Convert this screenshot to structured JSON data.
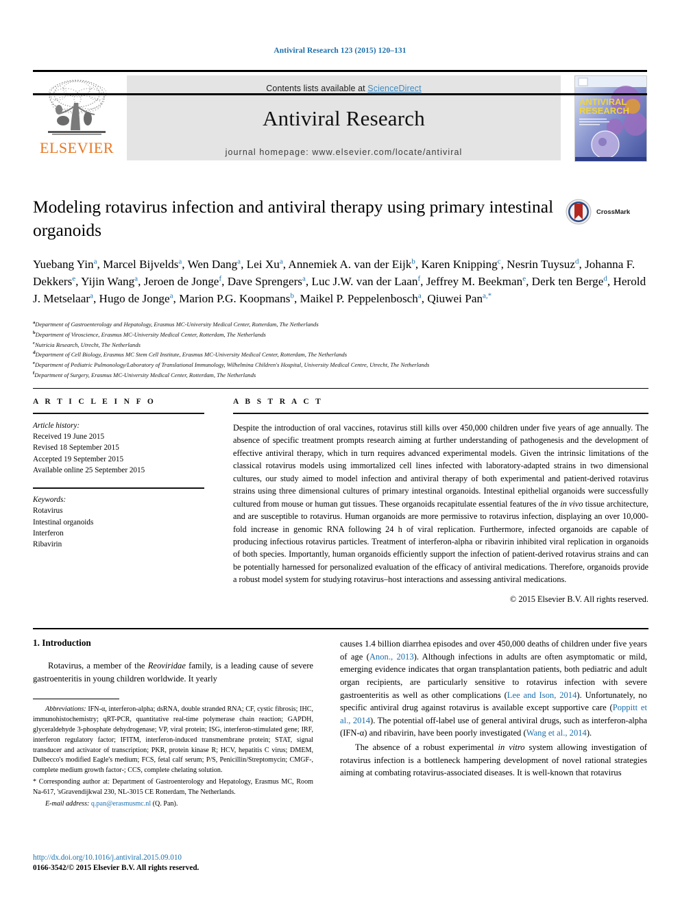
{
  "running_head": "Antiviral Research 123 (2015) 120–131",
  "masthead": {
    "contents_prefix": "Contents lists available at ",
    "science_direct": "ScienceDirect",
    "journal_name": "Antiviral Research",
    "homepage": "journal homepage: www.elsevier.com/locate/antiviral",
    "publisher_wordmark": "ELSEVIER",
    "cover_title_line1": "ANTIVIRAL",
    "cover_title_line2": "RESEARCH"
  },
  "crossmark": {
    "label": "CrossMark"
  },
  "title": "Modeling rotavirus infection and antiviral therapy using primary intestinal organoids",
  "authors_html": "Yuebang Yin<sup>a</sup>, Marcel Bijvelds<sup>a</sup>, Wen Dang<sup>a</sup>, Lei Xu<sup>a</sup>, Annemiek A. van der Eijk<sup>b</sup>, Karen Knipping<sup>c</sup>, Nesrin Tuysuz<sup>d</sup>, Johanna F. Dekkers<sup>e</sup>, Yijin Wang<sup>a</sup>, Jeroen de Jonge<sup>f</sup>, Dave Sprengers<sup>a</sup>, Luc J.W. van der Laan<sup>f</sup>, Jeffrey M. Beekman<sup>e</sup>, Derk ten Berge<sup>d</sup>, Herold J. Metselaar<sup>a</sup>, Hugo de Jonge<sup>a</sup>, Marion P.G. Koopmans<sup>b</sup>, Maikel P. Peppelenbosch<sup>a</sup>, Qiuwei Pan<sup>a,*</sup>",
  "affiliations": [
    {
      "mark": "a",
      "text": "Department of Gastroenterology and Hepatology, Erasmus MC-University Medical Center, Rotterdam, The Netherlands"
    },
    {
      "mark": "b",
      "text": "Department of Viroscience, Erasmus MC-University Medical Center, Rotterdam, The Netherlands"
    },
    {
      "mark": "c",
      "text": "Nutricia Research, Utrecht, The Netherlands"
    },
    {
      "mark": "d",
      "text": "Department of Cell Biology, Erasmus MC Stem Cell Institute, Erasmus MC-University Medical Center, Rotterdam, The Netherlands"
    },
    {
      "mark": "e",
      "text": "Department of Pediatric Pulmonology/Laboratory of Translational Immunology, Wilhelmina Children's Hospital, University Medical Centre, Utrecht, The Netherlands"
    },
    {
      "mark": "f",
      "text": "Department of Surgery, Erasmus MC-University Medical Center, Rotterdam, The Netherlands"
    }
  ],
  "article_info": {
    "heading": "A R T I C L E   I N F O",
    "history_label": "Article history:",
    "history": [
      "Received 19 June 2015",
      "Revised 18 September 2015",
      "Accepted 19 September 2015",
      "Available online 25 September 2015"
    ],
    "keywords_label": "Keywords:",
    "keywords": [
      "Rotavirus",
      "Intestinal organoids",
      "Interferon",
      "Ribavirin"
    ]
  },
  "abstract": {
    "heading": "A B S T R A C T",
    "html": "Despite the introduction of oral vaccines, rotavirus still kills over 450,000 children under five years of age annually. The absence of specific treatment prompts research aiming at further understanding of pathogenesis and the development of effective antiviral therapy, which in turn requires advanced experimental models. Given the intrinsic limitations of the classical rotavirus models using immortalized cell lines infected with laboratory-adapted strains in two dimensional cultures, our study aimed to model infection and antiviral therapy of both experimental and patient-derived rotavirus strains using three dimensional cultures of primary intestinal organoids. Intestinal epithelial organoids were successfully cultured from mouse or human gut tissues. These organoids recapitulate essential features of the <i>in vivo</i> tissue architecture, and are susceptible to rotavirus. Human organoids are more permissive to rotavirus infection, displaying an over 10,000-fold increase in genomic RNA following 24 h of viral replication. Furthermore, infected organoids are capable of producing infectious rotavirus particles. Treatment of interferon-alpha or ribavirin inhibited viral replication in organoids of both species. Importantly, human organoids efficiently support the infection of patient-derived rotavirus strains and can be potentially harnessed for personalized evaluation of the efficacy of antiviral medications. Therefore, organoids provide a robust model system for studying rotavirus–host interactions and assessing antiviral medications.",
    "copyright": "© 2015 Elsevier B.V. All rights reserved."
  },
  "body": {
    "section_heading": "1. Introduction",
    "left_para_1_html": "Rotavirus, a member of the <i>Reoviridae</i> family, is a leading cause of severe gastroenteritis in young children worldwide. It yearly",
    "right_para_1_html": "causes 1.4 billion diarrhea episodes and over 450,000 deaths of children under five years of age (<a class=\"cite\" href=\"#\">Anon., 2013</a>). Although infections in adults are often asymptomatic or mild, emerging evidence indicates that organ transplantation patients, both pediatric and adult organ recipients, are particularly sensitive to rotavirus infection with severe gastroenteritis as well as other complications (<a class=\"cite\" href=\"#\">Lee and Ison, 2014</a>). Unfortunately, no specific antiviral drug against rotavirus is available except supportive care (<a class=\"cite\" href=\"#\">Poppitt et al., 2014</a>). The potential off-label use of general antiviral drugs, such as interferon-alpha (IFN-α) and ribavirin, have been poorly investigated (<a class=\"cite\" href=\"#\">Wang et al., 2014</a>).",
    "right_para_2_html": "The absence of a robust experimental <i>in vitro</i> system allowing investigation of rotavirus infection is a bottleneck hampering development of novel rational strategies aiming at combating rotavirus-associated diseases. It is well-known that rotavirus"
  },
  "footnotes": {
    "abbreviations_html": "<span class=\"it\">Abbreviations:</span> IFN-α, interferon-alpha; dsRNA, double stranded RNA; CF, cystic fibrosis; IHC, immunohistochemistry; qRT-PCR, quantitative real-time polymerase chain reaction; GAPDH, glyceraldehyde 3-phosphate dehydrogenase; VP, viral protein; ISG, interferon-stimulated gene; IRF, interferon regulatory factor; IFITM, interferon-induced transmembrane protein; STAT, signal transducer and activator of transcription; PKR, protein kinase R; HCV, hepatitis C virus; DMEM, Dulbecco's modified Eagle's medium; FCS, fetal calf serum; P/S, Penicillin/Streptomycin; CMGF-, complete medium growth factor-; CCS, complete chelating solution.",
    "corresponding_html": "* Corresponding author at: Department of Gastroenterology and Hepatology, Erasmus MC, Room Na-617, 'sGravendijkwal 230, NL-3015 CE Rotterdam, The Netherlands.",
    "email_html": "<span class=\"it\">E-mail address:</span> <a class=\"footlink\" href=\"#\">q.pan@erasmusmc.nl</a> (Q. Pan)."
  },
  "footer": {
    "doi": "http://dx.doi.org/10.1016/j.antiviral.2015.09.010",
    "issn": "0166-3542/© 2015 Elsevier B.V. All rights reserved."
  },
  "colors": {
    "link": "#1a6eab",
    "elsevier_orange": "#e87722",
    "band_grey": "#e4e4e4"
  }
}
